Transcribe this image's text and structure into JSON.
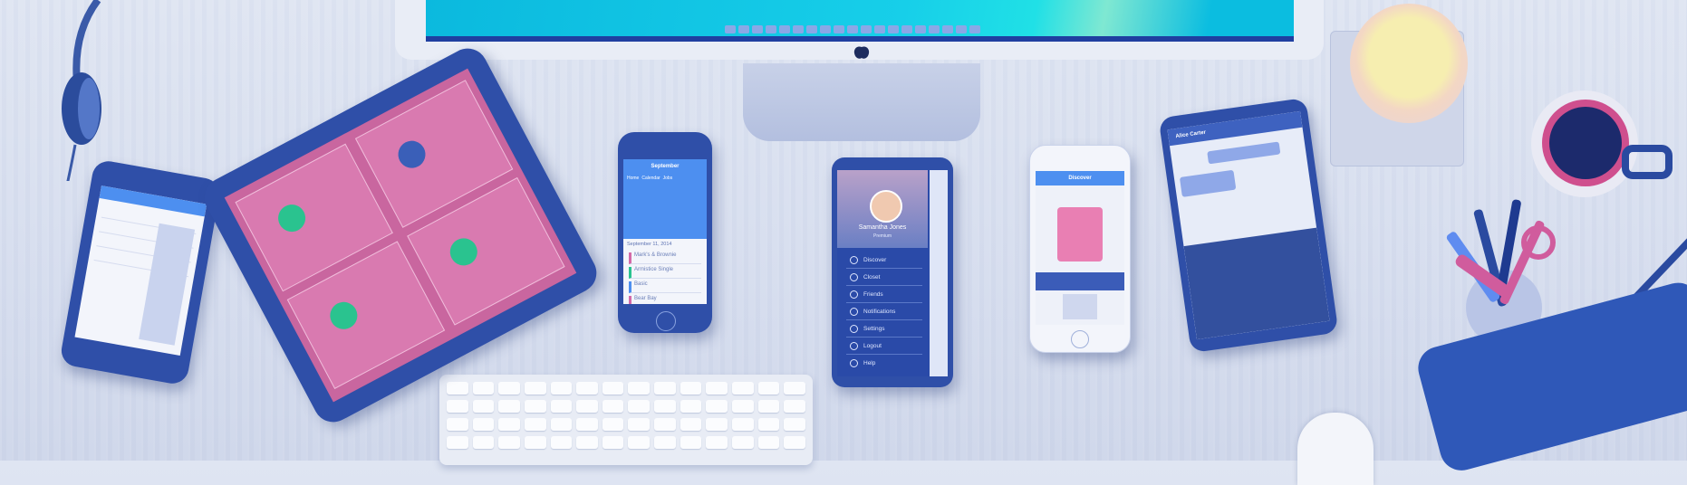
{
  "scene": {
    "colors": {
      "device": "#2f4fa8",
      "accent": "#4d8ff0",
      "pink": "#d46aa8",
      "cyan": "#17cfe9"
    }
  },
  "calendar_phone": {
    "month": "September",
    "tabs": [
      "Home",
      "Calendar",
      "Jobs"
    ],
    "date_heading": "September 11, 2014",
    "items": [
      "Mark's & Brownie",
      "Armistice Single",
      "Basic",
      "Bear Bay"
    ]
  },
  "menu_phone": {
    "user_name": "Samantha Jones",
    "user_role": "Premium",
    "items": [
      {
        "label": "Discover",
        "icon": "compass-icon"
      },
      {
        "label": "Closet",
        "icon": "hanger-icon"
      },
      {
        "label": "Friends",
        "icon": "people-icon"
      },
      {
        "label": "Notifications",
        "icon": "bell-icon"
      },
      {
        "label": "Settings",
        "icon": "gear-icon"
      },
      {
        "label": "Logout",
        "icon": "logout-icon"
      },
      {
        "label": "Help",
        "icon": "help-icon"
      }
    ]
  },
  "discover_phone": {
    "title": "Discover"
  },
  "chat_phone": {
    "contact": "Alice Carter"
  }
}
